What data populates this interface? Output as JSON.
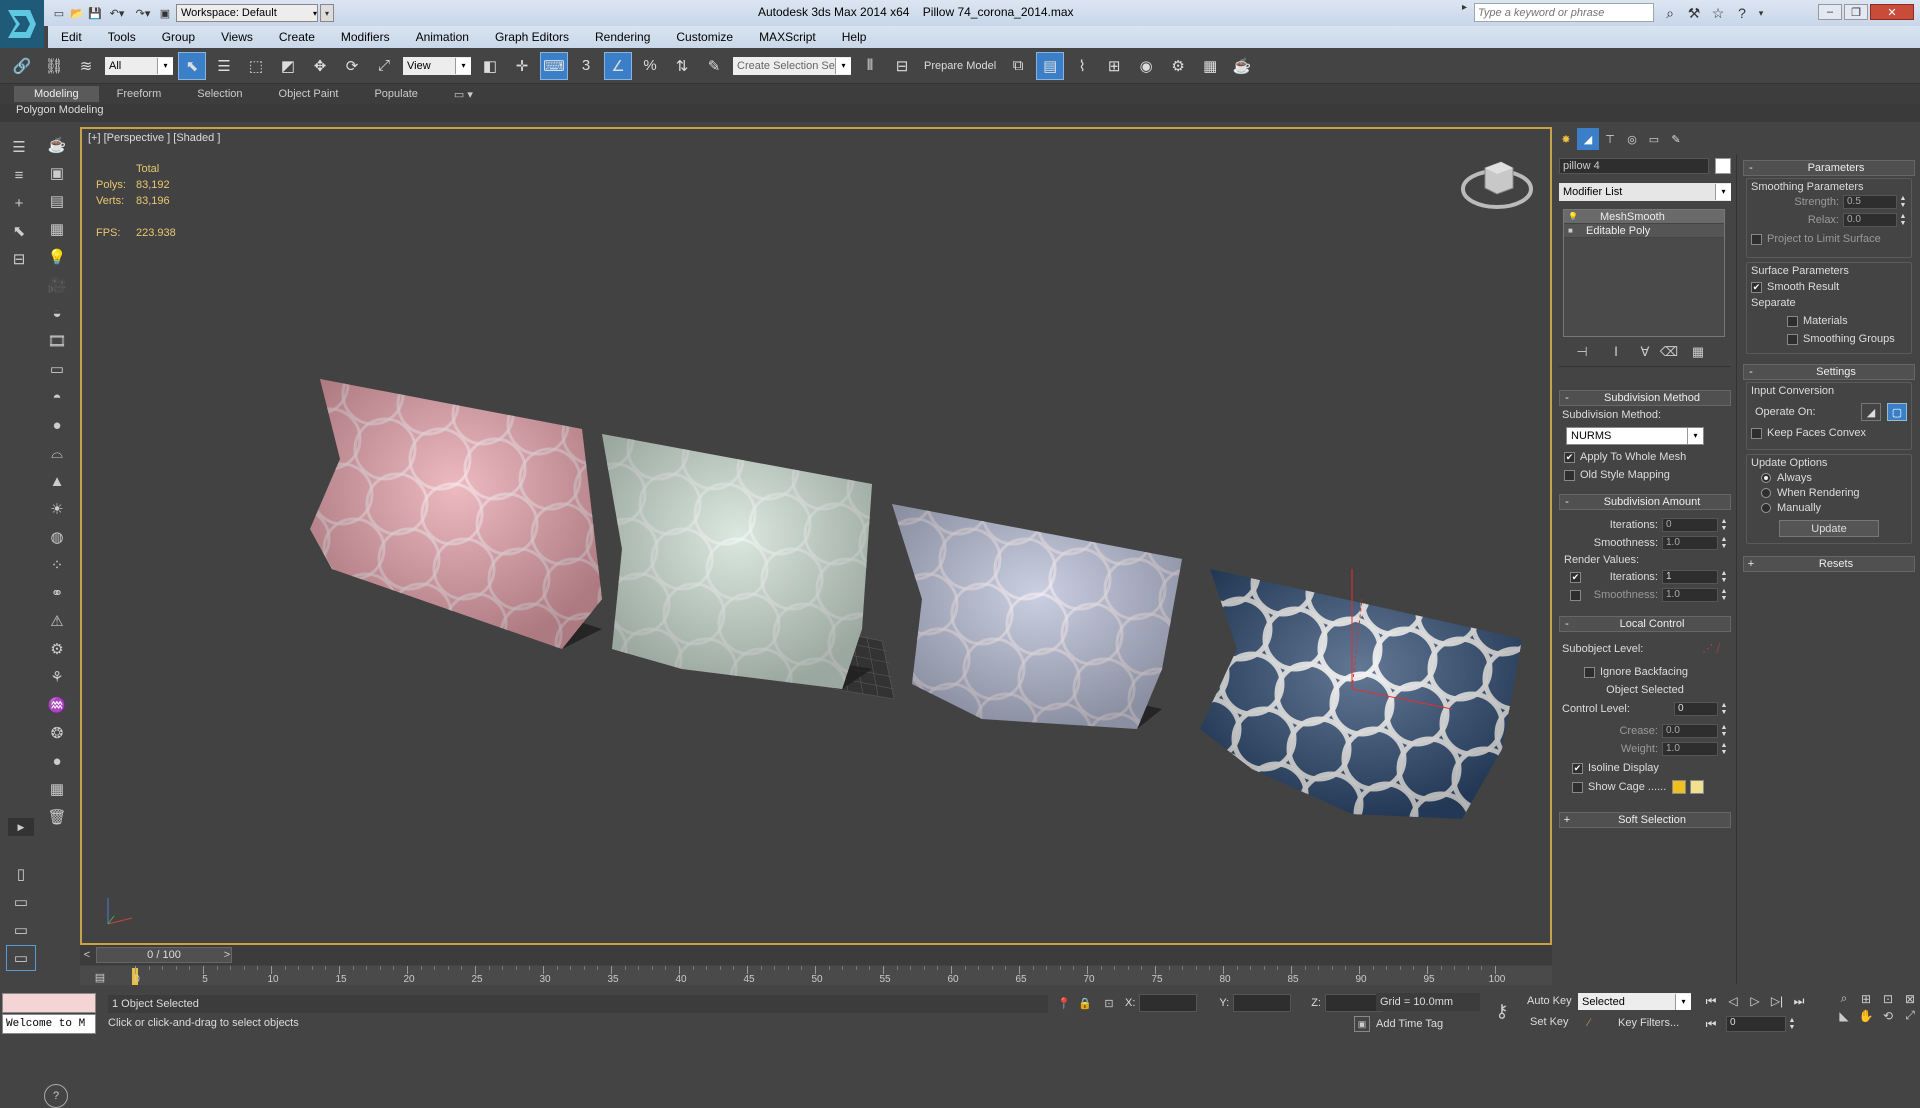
{
  "window": {
    "workspace": "Workspace: Default",
    "app_title": "Autodesk 3ds Max  2014 x64",
    "file_title": "Pillow 74_corona_2014.max",
    "search_placeholder": "Type a keyword or phrase"
  },
  "menu": [
    "Edit",
    "Tools",
    "Group",
    "Views",
    "Create",
    "Modifiers",
    "Animation",
    "Graph Editors",
    "Rendering",
    "Customize",
    "MAXScript",
    "Help"
  ],
  "toolbar": {
    "selection_filter": "All",
    "ref_coord": "View",
    "named_selection": "Create Selection Se",
    "prepare_model": "Prepare Model"
  },
  "ribbon": {
    "tabs": [
      "Modeling",
      "Freeform",
      "Selection",
      "Object Paint",
      "Populate"
    ],
    "active": "Modeling",
    "panel": "Polygon Modeling"
  },
  "viewport": {
    "label": "[+] [Perspective ] [Shaded ]",
    "stats": {
      "total_label": "Total",
      "polys_label": "Polys:",
      "polys": "83,192",
      "verts_label": "Verts:",
      "verts": "83,196",
      "fps_label": "FPS:",
      "fps": "223.938"
    },
    "pillows": [
      {
        "color": "#e8a3ad",
        "pattern": "#f3dbe0"
      },
      {
        "color": "#cfe0d6",
        "pattern": "#eef4ef"
      },
      {
        "color": "#b9bfd8",
        "pattern": "#f0e6ee"
      },
      {
        "color": "#2e4b72",
        "pattern": "#f1f1f1"
      }
    ]
  },
  "command_panel": {
    "object_name": "pillow 4",
    "modifier_list": "Modifier List",
    "stack": [
      "MeshSmooth",
      "Editable Poly"
    ],
    "subdivision_method": {
      "title": "Subdivision Method",
      "label": "Subdivision Method:",
      "value": "NURMS",
      "apply_whole": "Apply To Whole Mesh",
      "old_style": "Old Style Mapping"
    },
    "subdivision_amount": {
      "title": "Subdivision Amount",
      "iterations_label": "Iterations:",
      "iterations": "0",
      "smoothness_label": "Smoothness:",
      "smoothness": "1.0",
      "render_values": "Render Values:",
      "r_iterations_label": "Iterations:",
      "r_iterations": "1",
      "r_smoothness_label": "Smoothness:",
      "r_smoothness": "1.0"
    },
    "local_control": {
      "title": "Local Control",
      "subobject_level": "Subobject Level:",
      "ignore_backfacing": "Ignore Backfacing",
      "object_selected": "Object Selected",
      "control_level_label": "Control Level:",
      "control_level": "0",
      "crease_label": "Crease:",
      "crease": "0.0",
      "weight_label": "Weight:",
      "weight": "1.0",
      "isoline": "Isoline Display",
      "show_cage": "Show Cage ......"
    },
    "soft_selection": "Soft Selection",
    "parameters": {
      "title": "Parameters",
      "smoothing_params": "Smoothing Parameters",
      "strength_label": "Strength:",
      "strength": "0.5",
      "relax_label": "Relax:",
      "relax": "0.0",
      "project": "Project to Limit Surface",
      "surface_params": "Surface Parameters",
      "smooth_result": "Smooth Result",
      "separate": "Separate",
      "materials": "Materials",
      "smoothing_groups": "Smoothing Groups"
    },
    "settings": {
      "title": "Settings",
      "input_conversion": "Input Conversion",
      "operate_on": "Operate On:",
      "keep_faces": "Keep Faces Convex",
      "update_options": "Update Options",
      "always": "Always",
      "when_rendering": "When Rendering",
      "manually": "Manually",
      "update": "Update"
    },
    "resets": "Resets"
  },
  "timeline": {
    "frame": "0 / 100",
    "ticks": [
      "0",
      "5",
      "10",
      "15",
      "20",
      "25",
      "30",
      "35",
      "40",
      "45",
      "50",
      "55",
      "60",
      "65",
      "70",
      "75",
      "80",
      "85",
      "90",
      "95",
      "100"
    ]
  },
  "status": {
    "listener": "Welcome to M",
    "selected": "1 Object Selected",
    "prompt": "Click or click-and-drag to select objects",
    "x_label": "X:",
    "y_label": "Y:",
    "z_label": "Z:",
    "grid": "Grid = 10.0mm",
    "add_time_tag": "Add Time Tag",
    "auto_key": "Auto Key",
    "set_key": "Set Key",
    "selected_dd": "Selected",
    "key_filters": "Key Filters...",
    "frame_field": "0"
  }
}
